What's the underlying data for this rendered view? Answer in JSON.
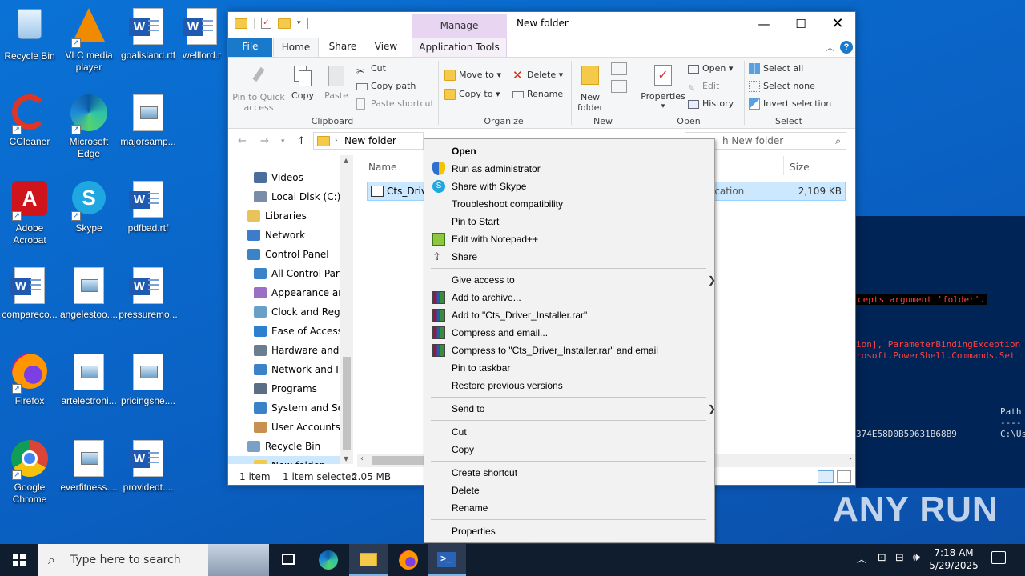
{
  "desktop": {
    "icons": [
      {
        "label": "Recycle Bin"
      },
      {
        "label": "VLC media player"
      },
      {
        "label": "goalisland.rtf"
      },
      {
        "label": "welllord.r"
      },
      {
        "label": "CCleaner"
      },
      {
        "label": "Microsoft Edge"
      },
      {
        "label": "majorsamp..."
      },
      {
        "label": "Adobe Acrobat"
      },
      {
        "label": "Skype"
      },
      {
        "label": "pdfbad.rtf"
      },
      {
        "label": "compareco..."
      },
      {
        "label": "angelestoo...."
      },
      {
        "label": "pressuremo..."
      },
      {
        "label": "Firefox"
      },
      {
        "label": "artelectroni..."
      },
      {
        "label": "pricingshe...."
      },
      {
        "label": "Google Chrome"
      },
      {
        "label": "everfitness...."
      },
      {
        "label": "providedt...."
      }
    ],
    "watermark": "ANY RUN"
  },
  "powershell": {
    "line1": "cepts argument 'folder'.",
    "line2": "ion], ParameterBindingException",
    "line3": "rosoft.PowerShell.Commands.Set",
    "line4": "Path",
    "line5": "----",
    "line6": "374E58D0B59631B68B9",
    "line7": "C:\\Us"
  },
  "explorer": {
    "title": "New folder",
    "manage_label": "Manage",
    "tabs": {
      "file": "File",
      "home": "Home",
      "share": "Share",
      "view": "View",
      "app_tools": "Application Tools"
    },
    "ribbon": {
      "pin": "Pin to Quick access",
      "copy": "Copy",
      "paste": "Paste",
      "cut": "Cut",
      "copy_path": "Copy path",
      "paste_shortcut": "Paste shortcut",
      "clipboard": "Clipboard",
      "move_to": "Move to",
      "copy_to": "Copy to",
      "delete": "Delete",
      "rename": "Rename",
      "organize": "Organize",
      "new_folder": "New folder",
      "new": "New",
      "properties": "Properties",
      "open": "Open",
      "edit": "Edit",
      "history": "History",
      "open_group": "Open",
      "select_all": "Select all",
      "select_none": "Select none",
      "invert_selection": "Invert selection",
      "select": "Select"
    },
    "address": {
      "path": "New folder",
      "search_placeholder": "h New folder"
    },
    "nav": [
      {
        "label": "Videos"
      },
      {
        "label": "Local Disk (C:)"
      },
      {
        "label": "Libraries"
      },
      {
        "label": "Network"
      },
      {
        "label": "Control Panel"
      },
      {
        "label": "All Control Par"
      },
      {
        "label": "Appearance an"
      },
      {
        "label": "Clock and Regi"
      },
      {
        "label": "Ease of Access"
      },
      {
        "label": "Hardware and"
      },
      {
        "label": "Network and Ir"
      },
      {
        "label": "Programs"
      },
      {
        "label": "System and Se"
      },
      {
        "label": "User Accounts"
      },
      {
        "label": "Recycle Bin"
      },
      {
        "label": "New folder"
      }
    ],
    "columns": {
      "name": "Name",
      "size": "Size"
    },
    "file": {
      "name": "Cts_Drive",
      "type": "ication",
      "size": "2,109 KB"
    },
    "status": {
      "count": "1 item",
      "selected": "1 item selected",
      "size": "2.05 MB"
    }
  },
  "context_menu": {
    "items": [
      {
        "label": "Open"
      },
      {
        "label": "Run as administrator"
      },
      {
        "label": "Share with Skype"
      },
      {
        "label": "Troubleshoot compatibility"
      },
      {
        "label": "Pin to Start"
      },
      {
        "label": "Edit with Notepad++"
      },
      {
        "label": "Share"
      },
      {
        "label": "Give access to"
      },
      {
        "label": "Add to archive..."
      },
      {
        "label": "Add to \"Cts_Driver_Installer.rar\""
      },
      {
        "label": "Compress and email..."
      },
      {
        "label": "Compress to \"Cts_Driver_Installer.rar\" and email"
      },
      {
        "label": "Pin to taskbar"
      },
      {
        "label": "Restore previous versions"
      },
      {
        "label": "Send to"
      },
      {
        "label": "Cut"
      },
      {
        "label": "Copy"
      },
      {
        "label": "Create shortcut"
      },
      {
        "label": "Delete"
      },
      {
        "label": "Rename"
      },
      {
        "label": "Properties"
      }
    ]
  },
  "taskbar": {
    "search_placeholder": "Type here to search",
    "time": "7:18 AM",
    "date": "5/29/2025"
  }
}
